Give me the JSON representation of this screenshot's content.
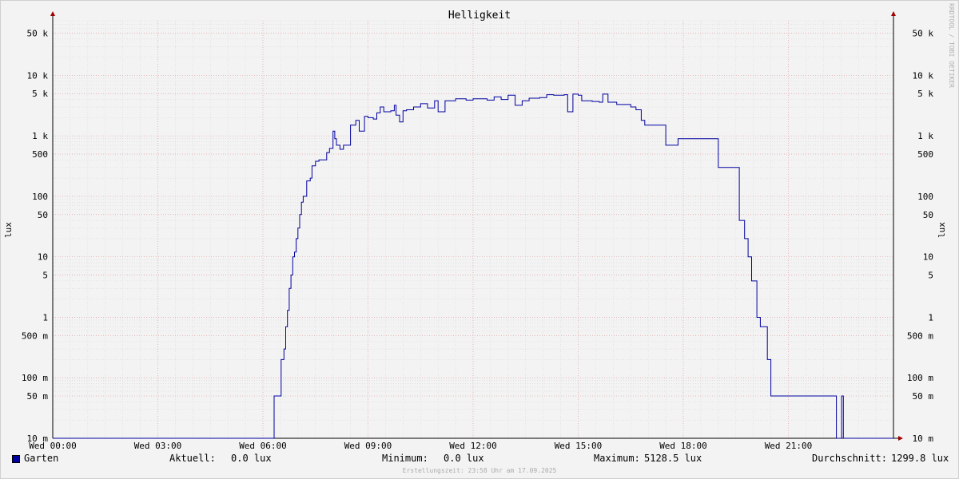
{
  "title": "Helligkeit",
  "watermark": "RRDTOOL / TOBI OETIKER",
  "footer": "Erstellungszeit: 23:58 Uhr am 17.09.2025",
  "colors": {
    "line": "#0000a0",
    "grid_major": "#e0a0a0",
    "grid_minor": "#d8d8d8",
    "axis": "#000000",
    "arrow": "#a00000"
  },
  "legend": {
    "series_name": "Garten",
    "current_label": "Aktuell:",
    "current_value": "0.0 lux",
    "min_label": "Minimum:",
    "min_value": "0.0 lux",
    "max_label": "Maximum:",
    "max_value": "5128.5 lux",
    "avg_label": "Durchschnitt:",
    "avg_value": "1299.8 lux"
  },
  "chart_data": {
    "type": "line",
    "title": "Helligkeit",
    "ylabel": "lux",
    "yscale": "log",
    "ylim": [
      0.01,
      80000
    ],
    "xlim": [
      0,
      24
    ],
    "x_unit": "hours",
    "grid": true,
    "x_ticks": [
      {
        "x": 0,
        "label": "Wed 00:00"
      },
      {
        "x": 3,
        "label": "Wed 03:00"
      },
      {
        "x": 6,
        "label": "Wed 06:00"
      },
      {
        "x": 9,
        "label": "Wed 09:00"
      },
      {
        "x": 12,
        "label": "Wed 12:00"
      },
      {
        "x": 15,
        "label": "Wed 15:00"
      },
      {
        "x": 18,
        "label": "Wed 18:00"
      },
      {
        "x": 21,
        "label": "Wed 21:00"
      }
    ],
    "y_ticks": [
      {
        "v": 0.01,
        "label": "10 m"
      },
      {
        "v": 0.05,
        "label": "50 m"
      },
      {
        "v": 0.1,
        "label": "100 m"
      },
      {
        "v": 0.5,
        "label": "500 m"
      },
      {
        "v": 1,
        "label": "1"
      },
      {
        "v": 5,
        "label": "5"
      },
      {
        "v": 10,
        "label": "10"
      },
      {
        "v": 50,
        "label": "50"
      },
      {
        "v": 100,
        "label": "100"
      },
      {
        "v": 500,
        "label": "500"
      },
      {
        "v": 1000,
        "label": "1 k"
      },
      {
        "v": 5000,
        "label": "5 k"
      },
      {
        "v": 10000,
        "label": "10 k"
      },
      {
        "v": 50000,
        "label": "50 k"
      }
    ],
    "series": [
      {
        "name": "Garten",
        "points": [
          [
            0,
            0.01
          ],
          [
            6.3,
            0.01
          ],
          [
            6.32,
            0.05
          ],
          [
            6.5,
            0.05
          ],
          [
            6.52,
            0.2
          ],
          [
            6.6,
            0.3
          ],
          [
            6.65,
            0.7
          ],
          [
            6.7,
            1.3
          ],
          [
            6.75,
            3
          ],
          [
            6.8,
            5
          ],
          [
            6.85,
            10
          ],
          [
            6.9,
            12
          ],
          [
            6.95,
            20
          ],
          [
            7.0,
            30
          ],
          [
            7.05,
            50
          ],
          [
            7.1,
            80
          ],
          [
            7.15,
            100
          ],
          [
            7.25,
            180
          ],
          [
            7.35,
            200
          ],
          [
            7.4,
            320
          ],
          [
            7.5,
            380
          ],
          [
            7.6,
            400
          ],
          [
            7.75,
            400
          ],
          [
            7.82,
            530
          ],
          [
            7.9,
            620
          ],
          [
            8.0,
            1200
          ],
          [
            8.05,
            900
          ],
          [
            8.1,
            700
          ],
          [
            8.2,
            600
          ],
          [
            8.3,
            700
          ],
          [
            8.5,
            1500
          ],
          [
            8.65,
            1800
          ],
          [
            8.75,
            1200
          ],
          [
            8.9,
            2100
          ],
          [
            9.0,
            2000
          ],
          [
            9.15,
            1900
          ],
          [
            9.25,
            2400
          ],
          [
            9.35,
            3000
          ],
          [
            9.45,
            2500
          ],
          [
            9.65,
            2600
          ],
          [
            9.75,
            3200
          ],
          [
            9.8,
            2200
          ],
          [
            9.9,
            1700
          ],
          [
            10.0,
            2600
          ],
          [
            10.1,
            2700
          ],
          [
            10.3,
            3000
          ],
          [
            10.5,
            3400
          ],
          [
            10.7,
            2900
          ],
          [
            10.9,
            3800
          ],
          [
            11.0,
            2500
          ],
          [
            11.2,
            3800
          ],
          [
            11.5,
            4100
          ],
          [
            11.8,
            3900
          ],
          [
            12.0,
            4100
          ],
          [
            12.2,
            4100
          ],
          [
            12.4,
            3900
          ],
          [
            12.6,
            4400
          ],
          [
            12.8,
            4000
          ],
          [
            13.0,
            4700
          ],
          [
            13.2,
            3200
          ],
          [
            13.4,
            3800
          ],
          [
            13.6,
            4200
          ],
          [
            13.9,
            4300
          ],
          [
            14.1,
            4800
          ],
          [
            14.3,
            4700
          ],
          [
            14.6,
            4800
          ],
          [
            14.7,
            2500
          ],
          [
            14.85,
            4900
          ],
          [
            15.0,
            4700
          ],
          [
            15.1,
            3800
          ],
          [
            15.4,
            3700
          ],
          [
            15.6,
            3600
          ],
          [
            15.7,
            4900
          ],
          [
            15.85,
            3600
          ],
          [
            16.1,
            3300
          ],
          [
            16.5,
            3000
          ],
          [
            16.65,
            2700
          ],
          [
            16.8,
            1800
          ],
          [
            16.9,
            1500
          ],
          [
            17.3,
            1500
          ],
          [
            17.5,
            700
          ],
          [
            17.8,
            700
          ],
          [
            17.85,
            900
          ],
          [
            18.0,
            900
          ],
          [
            18.95,
            900
          ],
          [
            19.0,
            300
          ],
          [
            19.55,
            300
          ],
          [
            19.6,
            40
          ],
          [
            19.75,
            20
          ],
          [
            19.85,
            10
          ],
          [
            19.95,
            4
          ],
          [
            20.1,
            1
          ],
          [
            20.2,
            0.7
          ],
          [
            20.4,
            0.2
          ],
          [
            20.5,
            0.05
          ],
          [
            22.35,
            0.05
          ],
          [
            22.37,
            0.01
          ],
          [
            22.5,
            0.01
          ],
          [
            22.52,
            0.05
          ],
          [
            22.55,
            0.05
          ],
          [
            22.57,
            0.01
          ],
          [
            24,
            0.01
          ]
        ]
      }
    ]
  }
}
